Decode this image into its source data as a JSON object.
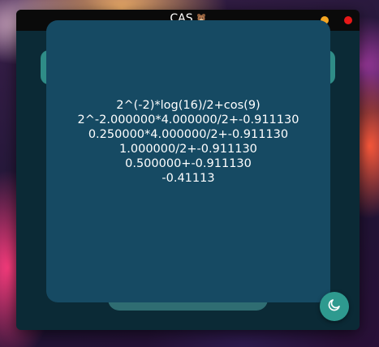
{
  "window": {
    "title": "CAS",
    "title_icon": "bear-emoji-icon"
  },
  "titlebar_buttons": {
    "minimize_color": "#f5a623",
    "close_color": "#e81818"
  },
  "result": {
    "lines": [
      "2^(-2)*log(16)/2+cos(9)",
      "2^-2.000000*4.000000/2+-0.911130",
      "0.250000*4.000000/2+-0.911130",
      "1.000000/2+-0.911130",
      "0.500000+-0.911130",
      "-0.41113"
    ]
  },
  "theme_toggle": {
    "icon": "moon-icon"
  },
  "colors": {
    "window_bg": "#0b2a36",
    "card_bg": "#164a63",
    "accent_teal": "#2e9a8f"
  }
}
